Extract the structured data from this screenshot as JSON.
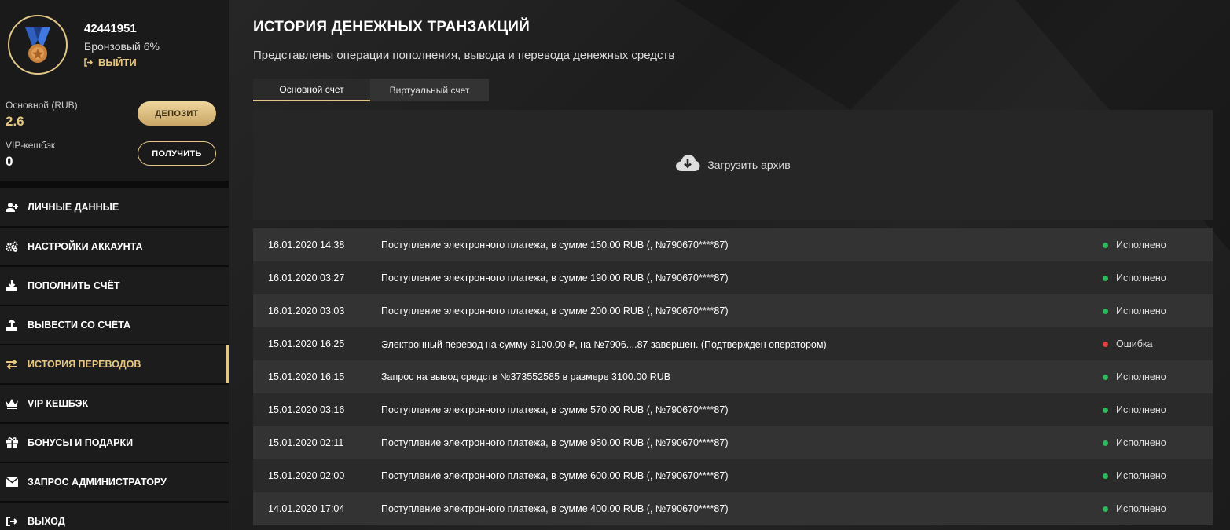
{
  "profile": {
    "user_id": "42441951",
    "level": "Бронзовый 6%",
    "logout_label": "ВЫЙТИ"
  },
  "balances": {
    "main_label": "Основной (RUB)",
    "main_value": "2.6",
    "vip_label": "VIP-кешбэк",
    "vip_value": "0",
    "deposit_button": "ДЕПОЗИТ",
    "receive_button": "ПОЛУЧИТЬ"
  },
  "menu": [
    {
      "label": "ЛИЧНЫЕ ДАННЫЕ",
      "icon": "user-plus-icon"
    },
    {
      "label": "НАСТРОЙКИ АККАУНТА",
      "icon": "gears-icon"
    },
    {
      "label": "ПОПОЛНИТЬ СЧЁТ",
      "icon": "download-icon"
    },
    {
      "label": "ВЫВЕСТИ СО СЧЁТА",
      "icon": "upload-icon"
    },
    {
      "label": "ИСТОРИЯ ПЕРЕВОДОВ",
      "icon": "exchange-icon",
      "active": true
    },
    {
      "label": "VIP КЕШБЭК",
      "icon": "crown-icon"
    },
    {
      "label": "БОНУСЫ И ПОДАРКИ",
      "icon": "gift-icon"
    },
    {
      "label": "ЗАПРОС АДМИНИСТРАТОРУ",
      "icon": "envelope-icon"
    },
    {
      "label": "ВЫХОД",
      "icon": "sign-out-icon"
    }
  ],
  "main": {
    "title": "ИСТОРИЯ ДЕНЕЖНЫХ ТРАНЗАКЦИЙ",
    "subtitle": "Представлены операции пополнения, вывода и перевода денежных средств",
    "tabs": [
      "Основной счет",
      "Виртуальный счет"
    ],
    "archive_label": "Загрузить архив"
  },
  "transactions": [
    {
      "date": "16.01.2020 14:38",
      "desc": "Поступление электронного платежа, в сумме 150.00 RUB (, №790670****87)",
      "status": "Исполнено"
    },
    {
      "date": "16.01.2020 03:27",
      "desc": "Поступление электронного платежа, в сумме 190.00 RUB (, №790670****87)",
      "status": "Исполнено"
    },
    {
      "date": "16.01.2020 03:03",
      "desc": "Поступление электронного платежа, в сумме 200.00 RUB (, №790670****87)",
      "status": "Исполнено"
    },
    {
      "date": "15.01.2020 16:25",
      "desc": "Электронный перевод на сумму 3100.00 ₽, на №7906....87 завершен. (Подтвержден оператором)",
      "status": "Ошибка"
    },
    {
      "date": "15.01.2020 16:15",
      "desc": "Запрос на вывод средств №373552585 в размере 3100.00 RUB",
      "status": "Исполнено"
    },
    {
      "date": "15.01.2020 03:16",
      "desc": "Поступление электронного платежа, в сумме 570.00 RUB (, №790670****87)",
      "status": "Исполнено"
    },
    {
      "date": "15.01.2020 02:11",
      "desc": "Поступление электронного платежа, в сумме 950.00 RUB (, №790670****87)",
      "status": "Исполнено"
    },
    {
      "date": "15.01.2020 02:00",
      "desc": "Поступление электронного платежа, в сумме 600.00 RUB (, №790670****87)",
      "status": "Исполнено"
    },
    {
      "date": "14.01.2020 17:04",
      "desc": "Поступление электронного платежа, в сумме 400.00 RUB (, №790670****87)",
      "status": "Исполнено"
    }
  ],
  "colors": {
    "accent": "#e2c789",
    "status_ok": "#2eb85c",
    "status_error": "#e0413c"
  }
}
